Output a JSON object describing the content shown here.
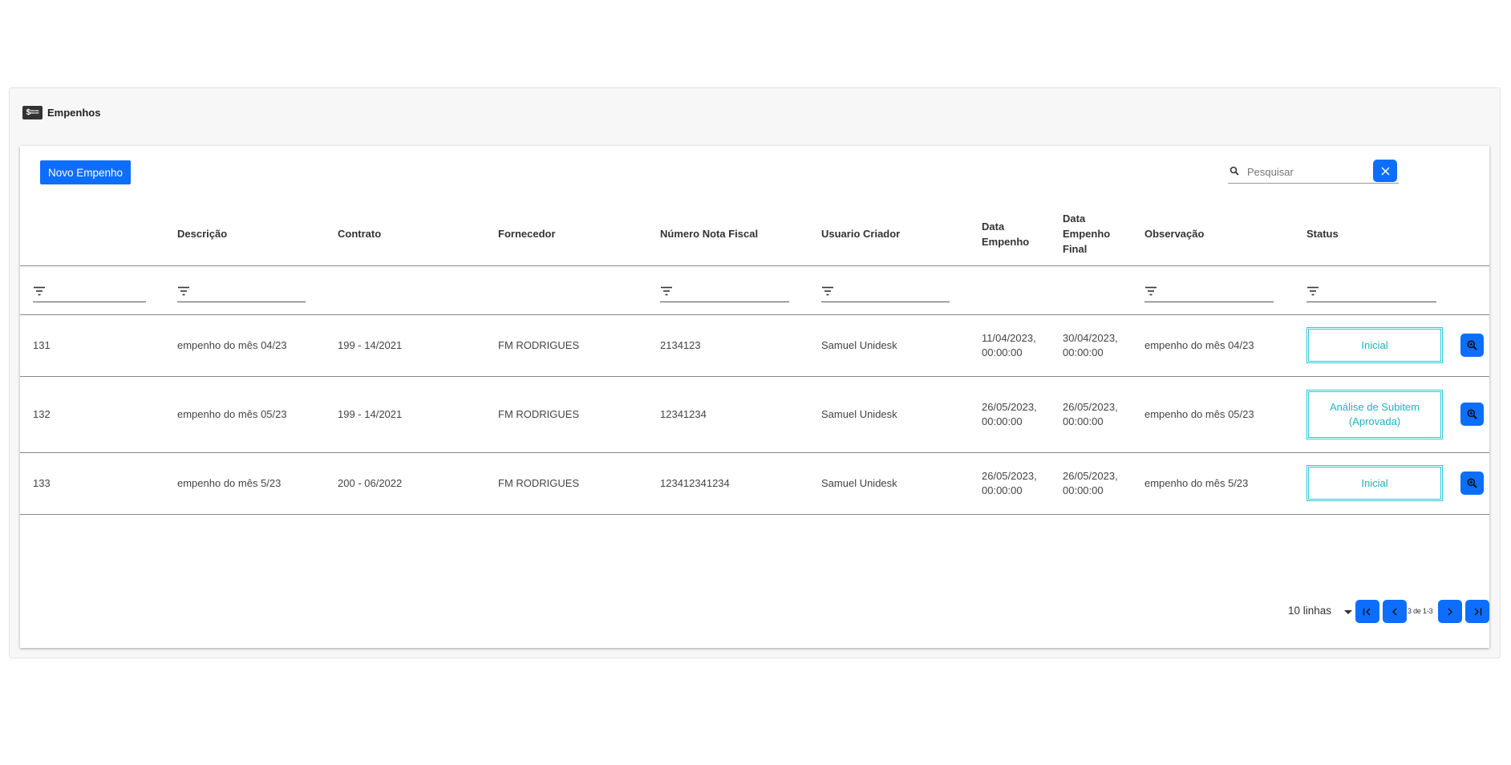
{
  "page": {
    "title": "Empenhos",
    "header_icon_text": "$=="
  },
  "toolbar": {
    "new_button": "Novo Empenho",
    "search_placeholder": "Pesquisar"
  },
  "table": {
    "columns": [
      "",
      "Descrição",
      "Contrato",
      "Fornecedor",
      "Número Nota Fiscal",
      "Usuario Criador",
      "Data Empenho",
      "Data Empenho Final",
      "Observação",
      "Status"
    ],
    "rows": [
      {
        "id": "131",
        "descricao": "empenho do mês 04/23",
        "contrato": "199 - 14/2021",
        "fornecedor": "FM RODRIGUES",
        "nota": "2134123",
        "usuario": "Samuel Unidesk",
        "data_empenho": "11/04/2023, 00:00:00",
        "data_final": "30/04/2023, 00:00:00",
        "observacao": "empenho do mês 04/23",
        "status": "Inicial"
      },
      {
        "id": "132",
        "descricao": "empenho do mês 05/23",
        "contrato": "199 - 14/2021",
        "fornecedor": "FM RODRIGUES",
        "nota": "12341234",
        "usuario": "Samuel Unidesk",
        "data_empenho": "26/05/2023, 00:00:00",
        "data_final": "26/05/2023, 00:00:00",
        "observacao": "empenho do mês 05/23",
        "status": "Análise de Subitem (Aprovada)"
      },
      {
        "id": "133",
        "descricao": "empenho do mês 5/23",
        "contrato": "200 - 06/2022",
        "fornecedor": "FM RODRIGUES",
        "nota": "123412341234",
        "usuario": "Samuel Unidesk",
        "data_empenho": "26/05/2023, 00:00:00",
        "data_final": "26/05/2023, 00:00:00",
        "observacao": "empenho do mês 5/23",
        "status": "Inicial"
      }
    ]
  },
  "pagination": {
    "rows_per_page": "10 linhas",
    "range_text": "3 de 1-3"
  },
  "colors": {
    "primary": "#0d6efd",
    "status_border": "#2ec8d6",
    "status_text": "#1bb3c4"
  },
  "icons": {
    "header": "money-list-icon",
    "search": "search-icon",
    "clear": "close-icon",
    "filter": "filter-icon",
    "zoom": "zoom-in-icon",
    "first": "first-page-icon",
    "prev": "chevron-left-icon",
    "next": "chevron-right-icon",
    "last": "last-page-icon",
    "dropdown": "caret-down-icon"
  }
}
